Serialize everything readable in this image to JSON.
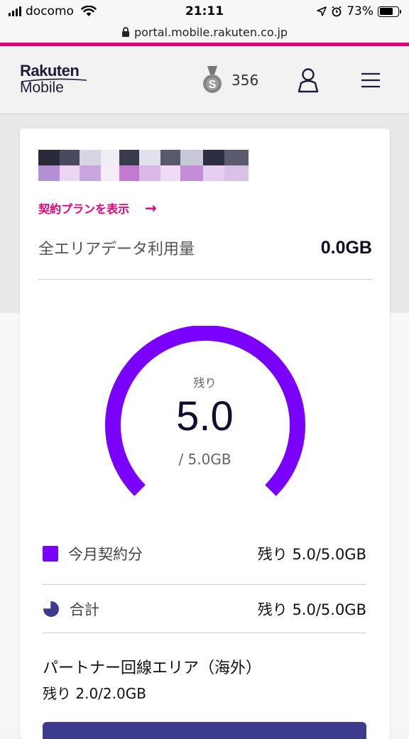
{
  "status_bar": {
    "carrier": "docomo",
    "time": "21:11",
    "battery_percent": "73%",
    "battery_level": 0.73
  },
  "browser": {
    "url": "portal.mobile.rakuten.co.jp"
  },
  "header": {
    "logo_line1": "Rakuten",
    "logo_line2": "Mobile",
    "points": "356",
    "medal_letter": "S"
  },
  "colors": {
    "accent_pink": "#e6007e",
    "gauge_purple": "#7a00ff",
    "pie_navy": "#3d3b8e"
  },
  "card": {
    "plan_link": "契約プランを表示",
    "plan_arrow": "→",
    "usage_label": "全エリアデータ利用量",
    "usage_value": "0.0GB",
    "gauge": {
      "caption": "残り",
      "remaining": "5.0",
      "total": "/ 5.0GB",
      "fill_fraction": 1.0
    },
    "legend": [
      {
        "label": "今月契約分",
        "value": "残り 5.0/5.0GB",
        "icon": "square-swatch-icon"
      },
      {
        "label": "合計",
        "value": "残り 5.0/5.0GB",
        "icon": "pie-icon"
      }
    ],
    "partner": {
      "title": "パートナー回線エリア（海外）",
      "value": "残り 2.0/2.0GB"
    }
  }
}
